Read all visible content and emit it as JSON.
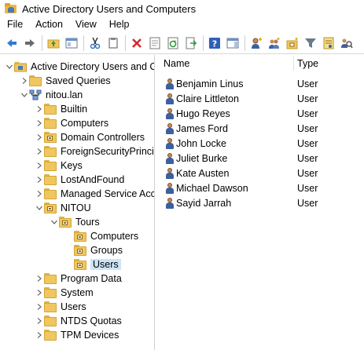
{
  "window": {
    "title": "Active Directory Users and Computers"
  },
  "menu": [
    "File",
    "Action",
    "View",
    "Help"
  ],
  "toolbar": [
    "back-arrow-icon",
    "forward-arrow-icon",
    "up-folder-icon",
    "show-console-tree-icon",
    "cut-icon",
    "copy-icon",
    "delete-icon",
    "properties-icon",
    "refresh-icon",
    "export-list-icon",
    "help-icon",
    "show-action-pane-icon",
    "new-user-icon",
    "new-group-icon",
    "new-ou-icon",
    "filter-icon",
    "add-to-group-icon",
    "find-icon"
  ],
  "tree": [
    {
      "label": "Active Directory Users and Com",
      "level": 0,
      "expand": "expanded",
      "icon": "adu-root-icon"
    },
    {
      "label": "Saved Queries",
      "level": 1,
      "expand": "collapsed",
      "icon": "folder-icon"
    },
    {
      "label": "nitou.lan",
      "level": 1,
      "expand": "expanded",
      "icon": "domain-icon"
    },
    {
      "label": "Builtin",
      "level": 2,
      "expand": "collapsed",
      "icon": "folder-icon"
    },
    {
      "label": "Computers",
      "level": 2,
      "expand": "collapsed",
      "icon": "folder-icon"
    },
    {
      "label": "Domain Controllers",
      "level": 2,
      "expand": "collapsed",
      "icon": "ou-icon"
    },
    {
      "label": "ForeignSecurityPrincipals",
      "level": 2,
      "expand": "collapsed",
      "icon": "folder-icon"
    },
    {
      "label": "Keys",
      "level": 2,
      "expand": "collapsed",
      "icon": "folder-icon"
    },
    {
      "label": "LostAndFound",
      "level": 2,
      "expand": "collapsed",
      "icon": "folder-icon"
    },
    {
      "label": "Managed Service Accoun",
      "level": 2,
      "expand": "collapsed",
      "icon": "folder-icon"
    },
    {
      "label": "NITOU",
      "level": 2,
      "expand": "expanded",
      "icon": "ou-icon"
    },
    {
      "label": "Tours",
      "level": 3,
      "expand": "expanded",
      "icon": "ou-icon"
    },
    {
      "label": "Computers",
      "level": 4,
      "expand": "none",
      "icon": "ou-icon"
    },
    {
      "label": "Groups",
      "level": 4,
      "expand": "none",
      "icon": "ou-icon"
    },
    {
      "label": "Users",
      "level": 4,
      "expand": "none",
      "icon": "ou-icon",
      "selected": true
    },
    {
      "label": "Program Data",
      "level": 2,
      "expand": "collapsed",
      "icon": "folder-icon"
    },
    {
      "label": "System",
      "level": 2,
      "expand": "collapsed",
      "icon": "folder-icon"
    },
    {
      "label": "Users",
      "level": 2,
      "expand": "collapsed",
      "icon": "folder-icon"
    },
    {
      "label": "NTDS Quotas",
      "level": 2,
      "expand": "collapsed",
      "icon": "folder-icon"
    },
    {
      "label": "TPM Devices",
      "level": 2,
      "expand": "collapsed",
      "icon": "folder-icon"
    }
  ],
  "list": {
    "columns": {
      "name": "Name",
      "type": "Type"
    },
    "rows": [
      {
        "name": "Benjamin Linus",
        "type": "User"
      },
      {
        "name": "Claire Littleton",
        "type": "User"
      },
      {
        "name": "Hugo Reyes",
        "type": "User"
      },
      {
        "name": "James Ford",
        "type": "User"
      },
      {
        "name": "John Locke",
        "type": "User"
      },
      {
        "name": "Juliet Burke",
        "type": "User"
      },
      {
        "name": "Kate Austen",
        "type": "User"
      },
      {
        "name": "Michael Dawson",
        "type": "User"
      },
      {
        "name": "Sayid Jarrah",
        "type": "User"
      }
    ]
  }
}
